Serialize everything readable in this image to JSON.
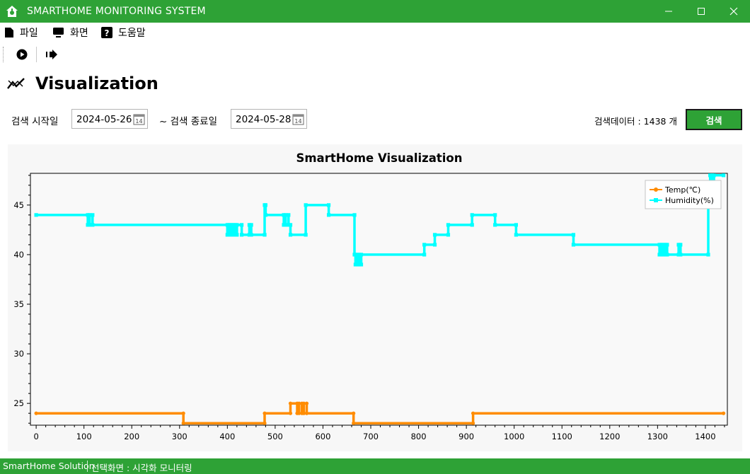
{
  "window": {
    "title": "SMARTHOME MONITORING SYSTEM"
  },
  "menu": {
    "items": [
      {
        "label": "파일"
      },
      {
        "label": "화면"
      },
      {
        "label": "도움말"
      }
    ]
  },
  "page": {
    "title": "Visualization"
  },
  "filters": {
    "start_label": "검색 시작일",
    "start_value": "2024-05-26",
    "end_label": "~ 검색 종료일",
    "end_value": "2024-05-28",
    "calendar_day": "14",
    "count_text": "검색데이터 : 1438 개",
    "search_label": "검색"
  },
  "status": {
    "app": "SmartHome Solution",
    "screen": "선택화면 : 시각화 모니터링"
  },
  "colors": {
    "accent": "#2ea236",
    "temp": "#ff8c00",
    "humidity": "#00ffff"
  },
  "chart_data": {
    "type": "line",
    "title": "SmartHome Visualization",
    "xlabel": "",
    "ylabel": "",
    "xlim": [
      -12,
      1446
    ],
    "ylim": [
      22.8,
      48.2
    ],
    "xticks": [
      0,
      100,
      200,
      300,
      400,
      500,
      600,
      700,
      800,
      900,
      1000,
      1100,
      1200,
      1300,
      1400
    ],
    "yticks": [
      25,
      30,
      35,
      40,
      45
    ],
    "legend": "top-right",
    "grid": false,
    "series": [
      {
        "name": "Temp(℃)",
        "color": "#ff8c00",
        "points": [
          [
            0,
            24
          ],
          [
            308,
            24
          ],
          [
            308,
            23
          ],
          [
            478,
            23
          ],
          [
            478,
            24
          ],
          [
            532,
            24
          ],
          [
            532,
            25
          ],
          [
            546,
            25
          ],
          [
            546,
            24
          ],
          [
            550,
            24
          ],
          [
            550,
            25
          ],
          [
            556,
            25
          ],
          [
            556,
            24
          ],
          [
            560,
            24
          ],
          [
            560,
            25
          ],
          [
            566,
            25
          ],
          [
            566,
            24
          ],
          [
            664,
            24
          ],
          [
            664,
            23
          ],
          [
            914,
            23
          ],
          [
            914,
            24
          ],
          [
            1438,
            24
          ]
        ]
      },
      {
        "name": "Humidity(%)",
        "color": "#00ffff",
        "points": [
          [
            0,
            44
          ],
          [
            108,
            44
          ],
          [
            108,
            43
          ],
          [
            112,
            43
          ],
          [
            112,
            44
          ],
          [
            118,
            44
          ],
          [
            118,
            43
          ],
          [
            400,
            43
          ],
          [
            400,
            42
          ],
          [
            404,
            42
          ],
          [
            404,
            43
          ],
          [
            408,
            43
          ],
          [
            408,
            42
          ],
          [
            412,
            42
          ],
          [
            412,
            43
          ],
          [
            416,
            43
          ],
          [
            416,
            42
          ],
          [
            420,
            42
          ],
          [
            420,
            43
          ],
          [
            430,
            43
          ],
          [
            430,
            42
          ],
          [
            446,
            42
          ],
          [
            446,
            43
          ],
          [
            450,
            43
          ],
          [
            450,
            42
          ],
          [
            478,
            42
          ],
          [
            478,
            45
          ],
          [
            480,
            45
          ],
          [
            480,
            44
          ],
          [
            518,
            44
          ],
          [
            518,
            43
          ],
          [
            522,
            43
          ],
          [
            522,
            44
          ],
          [
            528,
            44
          ],
          [
            528,
            43
          ],
          [
            532,
            43
          ],
          [
            532,
            42
          ],
          [
            564,
            42
          ],
          [
            564,
            45
          ],
          [
            612,
            45
          ],
          [
            612,
            44
          ],
          [
            666,
            44
          ],
          [
            666,
            40
          ],
          [
            668,
            40
          ],
          [
            668,
            39
          ],
          [
            672,
            39
          ],
          [
            672,
            40
          ],
          [
            676,
            40
          ],
          [
            676,
            39
          ],
          [
            680,
            39
          ],
          [
            680,
            40
          ],
          [
            812,
            40
          ],
          [
            812,
            41
          ],
          [
            834,
            41
          ],
          [
            834,
            42
          ],
          [
            862,
            42
          ],
          [
            862,
            43
          ],
          [
            912,
            43
          ],
          [
            912,
            44
          ],
          [
            960,
            44
          ],
          [
            960,
            43
          ],
          [
            1004,
            43
          ],
          [
            1004,
            42
          ],
          [
            1124,
            42
          ],
          [
            1124,
            41
          ],
          [
            1304,
            41
          ],
          [
            1304,
            40
          ],
          [
            1308,
            40
          ],
          [
            1308,
            41
          ],
          [
            1312,
            41
          ],
          [
            1312,
            40
          ],
          [
            1316,
            40
          ],
          [
            1316,
            41
          ],
          [
            1320,
            41
          ],
          [
            1320,
            40
          ],
          [
            1344,
            40
          ],
          [
            1344,
            41
          ],
          [
            1348,
            41
          ],
          [
            1348,
            40
          ],
          [
            1406,
            40
          ],
          [
            1406,
            47
          ],
          [
            1410,
            47
          ],
          [
            1410,
            48
          ],
          [
            1414,
            48
          ],
          [
            1414,
            47
          ],
          [
            1418,
            47
          ],
          [
            1418,
            48
          ],
          [
            1438,
            48
          ]
        ]
      }
    ]
  }
}
